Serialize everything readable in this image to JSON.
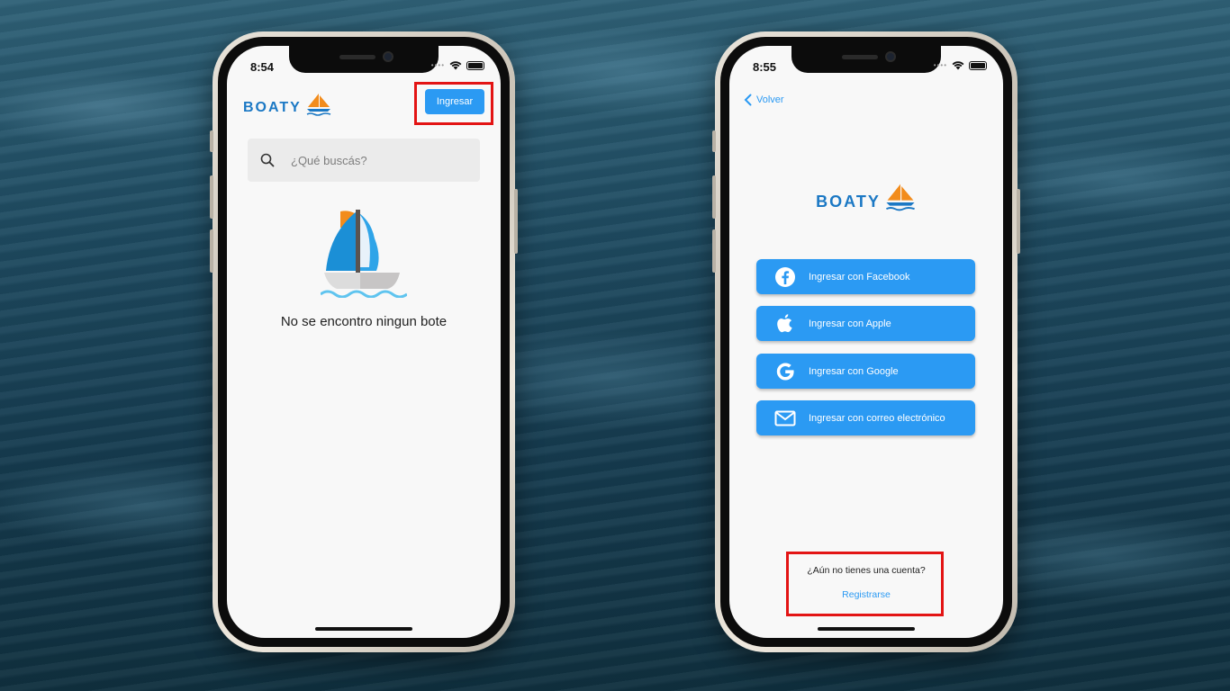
{
  "left_phone": {
    "status_time": "8:54",
    "logo_text": "BOATY",
    "login_button_label": "Ingresar",
    "search": {
      "placeholder": "¿Qué buscás?"
    },
    "empty_state_text": "No se encontro ningun bote"
  },
  "right_phone": {
    "status_time": "8:55",
    "back_label": "Volver",
    "logo_text": "BOATY",
    "login_options": [
      {
        "label": "Ingresar con Facebook",
        "icon": "facebook-icon"
      },
      {
        "label": "Ingresar con Apple",
        "icon": "apple-icon"
      },
      {
        "label": "Ingresar con Google",
        "icon": "google-icon"
      },
      {
        "label": "Ingresar con correo electrónico",
        "icon": "mail-icon"
      }
    ],
    "no_account_text": "¿Aún no tienes una cuenta?",
    "register_label": "Registrarse"
  },
  "colors": {
    "accent": "#2b9af3",
    "brand": "#1b78c4",
    "highlight": "#e31414",
    "sail_orange": "#f28c1c"
  }
}
